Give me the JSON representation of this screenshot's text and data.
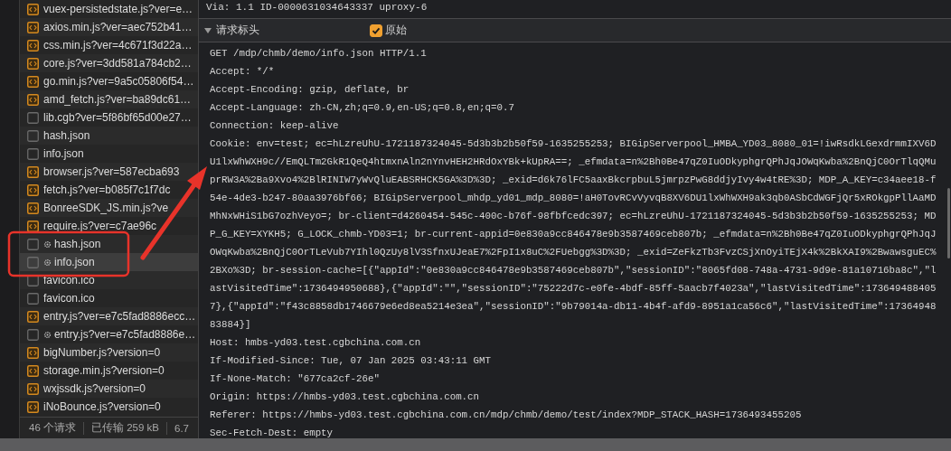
{
  "network_list": {
    "items": [
      {
        "name": "vuex-persistedstate.js?ver=e…",
        "kind": "script",
        "service_worker": false,
        "selected": false
      },
      {
        "name": "axios.min.js?ver=aec752b41…",
        "kind": "script",
        "service_worker": false,
        "selected": false
      },
      {
        "name": "css.min.js?ver=4c671f3d22a…",
        "kind": "script",
        "service_worker": false,
        "selected": false
      },
      {
        "name": "core.js?ver=3dd581a784cb2…",
        "kind": "script",
        "service_worker": false,
        "selected": false
      },
      {
        "name": "go.min.js?ver=9a5c05806f54…",
        "kind": "script",
        "service_worker": false,
        "selected": false
      },
      {
        "name": "amd_fetch.js?ver=ba89dc61…",
        "kind": "script",
        "service_worker": false,
        "selected": false
      },
      {
        "name": "lib.cgb?ver=5f86bf65d00e27…",
        "kind": "document",
        "service_worker": false,
        "selected": false
      },
      {
        "name": "hash.json",
        "kind": "document",
        "service_worker": false,
        "selected": false
      },
      {
        "name": "info.json",
        "kind": "document",
        "service_worker": false,
        "selected": false
      },
      {
        "name": "browser.js?ver=587ecba693",
        "kind": "script",
        "service_worker": false,
        "selected": false
      },
      {
        "name": "fetch.js?ver=b085f7c1f7dc",
        "kind": "script",
        "service_worker": false,
        "selected": false
      },
      {
        "name": "BonreeSDK_JS.min.js?ve",
        "kind": "script",
        "service_worker": false,
        "selected": false
      },
      {
        "name": "require.js?ver=c7ae96c",
        "kind": "script",
        "service_worker": false,
        "selected": false
      },
      {
        "name": "hash.json",
        "kind": "document",
        "service_worker": true,
        "selected": false
      },
      {
        "name": "info.json",
        "kind": "document",
        "service_worker": true,
        "selected": true
      },
      {
        "name": "favicon.ico",
        "kind": "document",
        "service_worker": false,
        "selected": false
      },
      {
        "name": "favicon.ico",
        "kind": "document",
        "service_worker": false,
        "selected": false
      },
      {
        "name": "entry.js?ver=e7c5fad8886ecc…",
        "kind": "script",
        "service_worker": false,
        "selected": false
      },
      {
        "name": "entry.js?ver=e7c5fad8886e…",
        "kind": "document",
        "service_worker": true,
        "selected": false
      },
      {
        "name": "bigNumber.js?version=0",
        "kind": "script",
        "service_worker": false,
        "selected": false
      },
      {
        "name": "storage.min.js?version=0",
        "kind": "script",
        "service_worker": false,
        "selected": false
      },
      {
        "name": "wxjssdk.js?version=0",
        "kind": "script",
        "service_worker": false,
        "selected": false
      },
      {
        "name": "iNoBounce.js?version=0",
        "kind": "script",
        "service_worker": false,
        "selected": false
      }
    ]
  },
  "status_bar": {
    "items": [
      "46 个请求",
      "已传输 259 kB",
      "6.7"
    ]
  },
  "response_headers_tail": "Via: 1.1 ID-0000631034643337 uproxy-6",
  "request_headers": {
    "title": "请求标头",
    "expanded": true,
    "raw_toggle": {
      "label": "原始",
      "checked": true
    },
    "lines": [
      "GET /mdp/chmb/demo/info.json HTTP/1.1",
      "Accept: */*",
      "Accept-Encoding: gzip, deflate, br",
      "Accept-Language: zh-CN,zh;q=0.9,en-US;q=0.8,en;q=0.7",
      "Connection: keep-alive",
      "Cookie: env=test; ec=hLzreUhU-1721187324045-5d3b3b2b50f59-1635255253; BIGipServerpool_HMBA_YD03_8080_01=!iwRsdkLGexdrmmIXV6D",
      "U1lxWhWXH9c//EmQLTm2GkR1QeQ4htmxnAln2nYnvHEH2HRdOxYBk+kUpRA==; _efmdata=n%2Bh0Be47qZ0IuODkyphgrQPhJqJOWqKwba%2BnQjC0OrTlqQMu",
      "prRW3A%2Ba9Xvo4%2BlRINIW7yWvQluEABSRHCK5GA%3D%3D; _exid=d6k76lFC5aaxBkcrpbuL5jmrpzPwG8ddjyIvy4w4tRE%3D; MDP_A_KEY=c34aee18-f",
      "54e-4de3-b247-80aa3976bf66; BIGipServerpool_mhdp_yd01_mdp_8080=!aH0TovRCvVyvqB8XV6DU1lxWhWXH9ak3qb0ASbCdWGFjQr5xROkgpPllAaMD",
      "MhNxWHiS1bG7ozhVeyo=; br-client=d4260454-545c-400c-b76f-98fbfcedc397; ec=hLzreUhU-1721187324045-5d3b3b2b50f59-1635255253; MD",
      "P_G_KEY=XYKH5; G_LOCK_chmb-YD03=1; br-current-appid=0e830a9cc846478e9b3587469ceb807b; _efmdata=n%2Bh0Be47qZ0IuODkyphgrQPhJqJ",
      "OWqKwba%2BnQjC0OrTLeVub7YIhl0QzUy8lV3SfnxUJeaE7%2FpI1x8uC%2FUebgg%3D%3D; _exid=ZeFkzTb3FvzCSjXnOyiTEjX4k%2BkXAI9%2BwawsguEC%",
      "2BXo%3D; br-session-cache=[{\"appId\":\"0e830a9cc846478e9b3587469ceb807b\",\"sessionID\":\"8065fd08-748a-4731-9d9e-81a10716ba8c\",\"l",
      "astVisitedTime\":1736494950688},{\"appId\":\"\",\"sessionID\":\"75222d7c-e0fe-4bdf-85ff-5aacb7f4023a\",\"lastVisitedTime\":173649488405",
      "7},{\"appId\":\"f43c8858db1746679e6ed8ea5214e3ea\",\"sessionID\":\"9b79014a-db11-4b4f-afd9-8951a1ca56c6\",\"lastVisitedTime\":17364948",
      "83884}]",
      "Host: hmbs-yd03.test.cgbchina.com.cn",
      "If-Modified-Since: Tue, 07 Jan 2025 03:43:11 GMT",
      "If-None-Match: \"677ca2cf-26e\"",
      "Origin: https://hmbs-yd03.test.cgbchina.com.cn",
      "Referer: https://hmbs-yd03.test.cgbchina.com.cn/mdp/chmb/demo/test/index?MDP_STACK_HASH=1736493455205",
      "Sec-Fetch-Dest: empty"
    ]
  }
}
